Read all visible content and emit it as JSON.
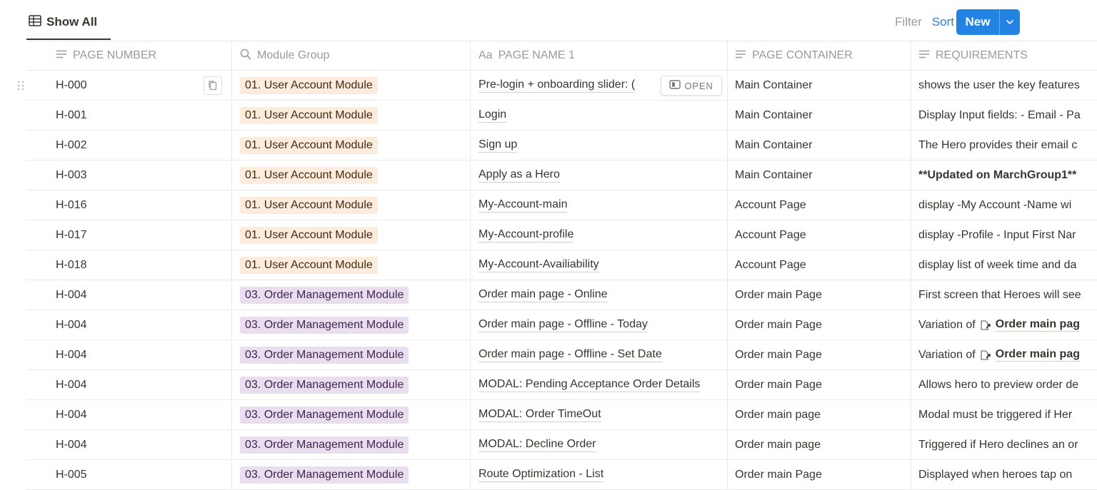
{
  "view": {
    "tab_label": "Show All",
    "tab_icon": "table-icon"
  },
  "toolbar": {
    "filter_label": "Filter",
    "sort_label": "Sort",
    "automation_icon": "lightning-icon",
    "search_icon": "search-icon",
    "more_icon": "more-icon",
    "new_label": "New",
    "colors": {
      "accent": "#2383e2",
      "muted": "#9b9a97"
    }
  },
  "columns": [
    {
      "label": "PAGE NUMBER",
      "icon": "text-lines-icon"
    },
    {
      "label": "Module Group",
      "icon": "search-icon"
    },
    {
      "label": "PAGE NAME 1",
      "icon_text": "Aa"
    },
    {
      "label": "PAGE CONTAINER",
      "icon": "text-lines-icon"
    },
    {
      "label": "REQUIREMENTS",
      "icon": "text-lines-icon"
    }
  ],
  "open_label": "OPEN",
  "tag_colors": {
    "user": "#fbecdd",
    "order": "#e8deee"
  },
  "rows": [
    {
      "page_number": "H-000",
      "module_group": "01. User Account Module",
      "tag": "user",
      "page_name": "Pre-login + onboarding slider: (",
      "page_name_tail": "",
      "page_container": "Main Container",
      "requirements": "shows the user the key features"
    },
    {
      "page_number": "H-001",
      "module_group": "01. User Account Module",
      "tag": "user",
      "page_name": "Login",
      "page_container": "Main Container",
      "requirements": "Display Input fields: - Email - Pa"
    },
    {
      "page_number": "H-002",
      "module_group": "01. User Account Module",
      "tag": "user",
      "page_name": "Sign up",
      "page_container": "Main Container",
      "requirements": "The Hero provides their email c"
    },
    {
      "page_number": "H-003",
      "module_group": "01. User Account Module",
      "tag": "user",
      "page_name": "Apply as a Hero",
      "page_container": "Main Container",
      "requirements": "**Updated on MarchGroup1**"
    },
    {
      "page_number": "H-016",
      "module_group": "01. User Account Module",
      "tag": "user",
      "page_name": "My-Account-main",
      "page_container": "Account Page",
      "requirements": "display -My Account -Name wi"
    },
    {
      "page_number": "H-017",
      "module_group": "01. User Account Module",
      "tag": "user",
      "page_name": "My-Account-profile",
      "page_container": "Account Page",
      "requirements": "display -Profile - Input First Nar"
    },
    {
      "page_number": "H-018",
      "module_group": "01. User Account Module",
      "tag": "user",
      "page_name": "My-Account-Availiability",
      "page_container": "Account Page",
      "requirements": "display list of week time and da"
    },
    {
      "page_number": "H-004",
      "module_group": "03. Order Management Module",
      "tag": "order",
      "page_name": "Order main page - Online",
      "page_container": "Order main Page",
      "requirements": "First screen that Heroes will see"
    },
    {
      "page_number": "H-004",
      "module_group": "03. Order Management Module",
      "tag": "order",
      "page_name": "Order main page - Offline - Today",
      "page_container": "Order main Page",
      "requirements": "Variation of",
      "requirements_link": "Order main pag"
    },
    {
      "page_number": "H-004",
      "module_group": "03. Order Management Module",
      "tag": "order",
      "page_name": "Order main page - Offline - Set Date",
      "page_container": "Order main Page",
      "requirements": "Variation of",
      "requirements_link": "Order main pag"
    },
    {
      "page_number": "H-004",
      "module_group": "03. Order Management Module",
      "tag": "order",
      "page_name": "MODAL: Pending Acceptance Order Details",
      "page_container": "Order main Page",
      "requirements": "Allows hero to preview order de"
    },
    {
      "page_number": "H-004",
      "module_group": "03. Order Management Module",
      "tag": "order",
      "page_name": "MODAL: Order TimeOut",
      "page_container": "Order main page",
      "requirements": "Modal must be triggered if Her"
    },
    {
      "page_number": "H-004",
      "module_group": "03. Order Management Module",
      "tag": "order",
      "page_name": "MODAL: Decline Order",
      "page_container": "Order main page",
      "requirements": "Triggered if Hero declines an or"
    },
    {
      "page_number": "H-005",
      "module_group": "03. Order Management Module",
      "tag": "order",
      "page_name": "Route Optimization - List",
      "page_container": "Order main Page",
      "requirements": "Displayed when heroes tap on"
    }
  ]
}
